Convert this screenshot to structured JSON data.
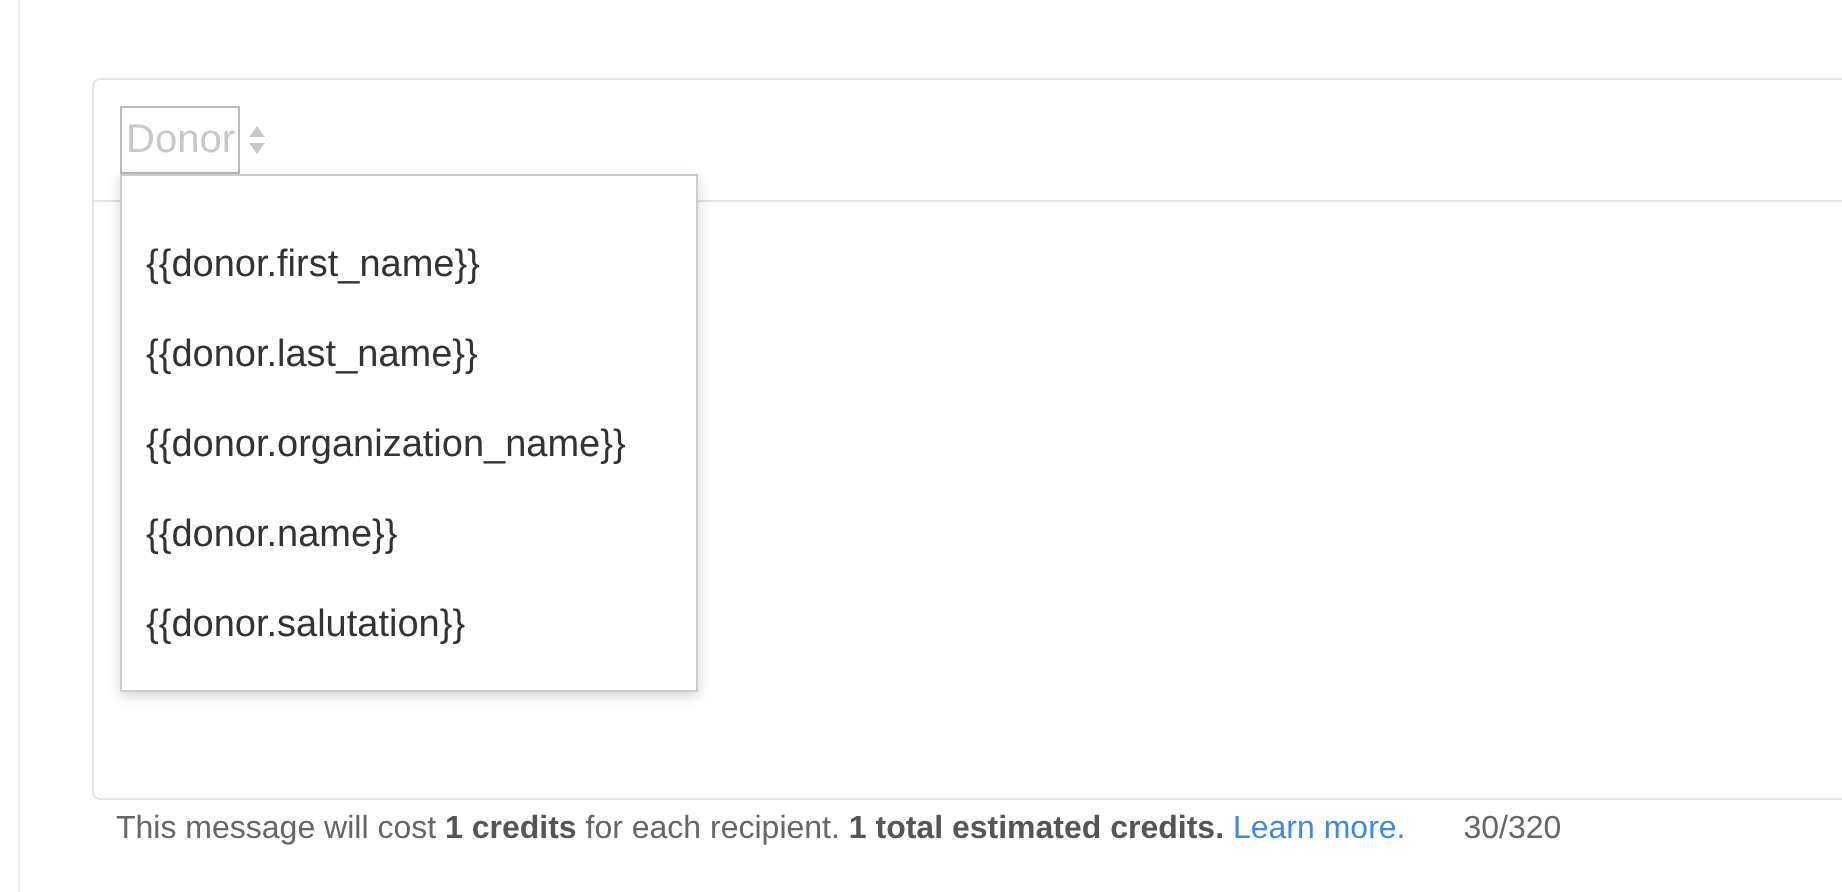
{
  "merge_field_select": {
    "value": "Donor",
    "expanded": true
  },
  "merge_field_menu": [
    {
      "label": "{{donor.first_name}}"
    },
    {
      "label": "{{donor.last_name}}"
    },
    {
      "label": "{{donor.organization_name}}"
    },
    {
      "label": "{{donor.name}}"
    },
    {
      "label": "{{donor.salutation}}"
    }
  ],
  "footer": {
    "cost_note": "This message will cost **1 credits** for each recipient. **1 total estimated credits.**",
    "link": "Learn more.",
    "character_count": "30/320"
  }
}
